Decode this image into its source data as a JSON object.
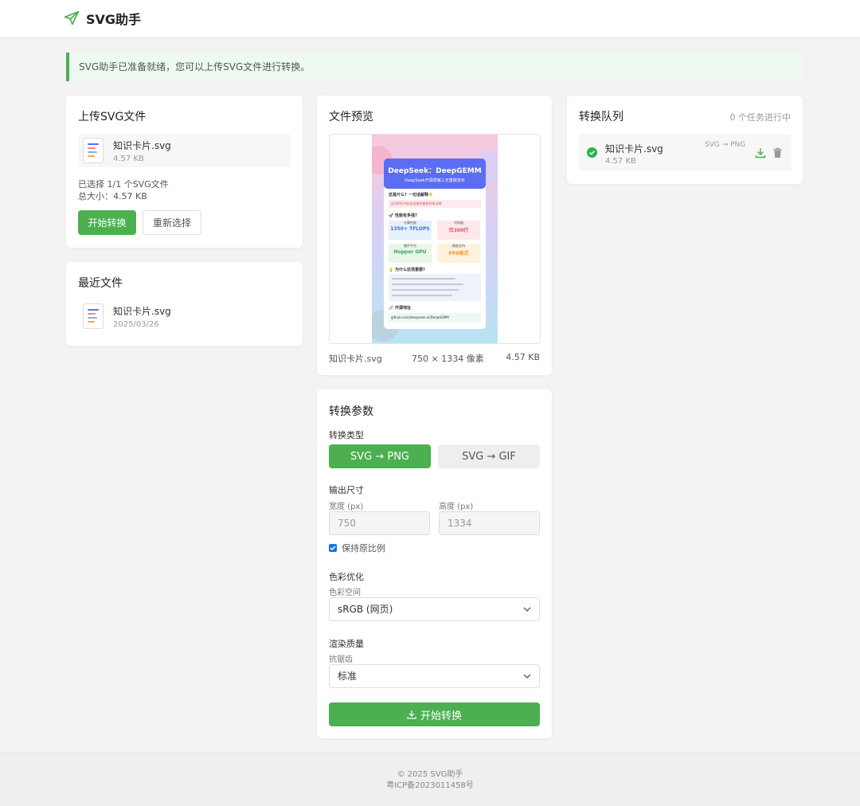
{
  "app": {
    "title": "SVG助手"
  },
  "notice": "SVG助手已准备就绪，您可以上传SVG文件进行转换。",
  "upload": {
    "title": "上传SVG文件",
    "file_name": "知识卡片.svg",
    "file_size": "4.57 KB",
    "selected_text": "已选择 1/1 个SVG文件",
    "total_size": "总大小：4.57 KB",
    "start_button": "开始转换",
    "reselect_button": "重新选择"
  },
  "recent": {
    "title": "最近文件",
    "file_name": "知识卡片.svg",
    "date": "2025/03/26"
  },
  "preview": {
    "title": "文件预览",
    "file_name": "知识卡片.svg",
    "dimensions": "750 × 1334 像素",
    "size": "4.57 KB",
    "card": {
      "heading": "DeepSeek：DeepGEMM",
      "subheading": "DeepSeek开源周第三天重磅发布",
      "q1": "这是什么？一句话解释👇",
      "line1": "仅300行代码实现高性能矩阵乘法库",
      "q2": "🚀 性能有多强?",
      "m1_label": "计算性能",
      "m1_value": "1350+ TFLOPS",
      "m2_label": "代码量",
      "m2_value": "仅300行",
      "m3_label": "硬件平台",
      "m3_value": "Hopper GPU",
      "m4_label": "精度支持",
      "m4_value": "FP8格式",
      "q3": "💡 为什么这很重要?",
      "q4": "🔗 开源地址",
      "link": "github.com/deepseek-ai/DeepGEMM"
    }
  },
  "params": {
    "title": "转换参数",
    "type_label": "转换类型",
    "type_png": "SVG → PNG",
    "type_gif": "SVG → GIF",
    "size_label": "输出尺寸",
    "width_label": "宽度 (px)",
    "height_label": "高度 (px)",
    "width_value": "750",
    "height_value": "1334",
    "keep_ratio": "保持原比例",
    "color_label": "色彩优化",
    "color_space_label": "色彩空间",
    "color_space_value": "sRGB (网页)",
    "quality_label": "渲染质量",
    "aa_label": "抗锯齿",
    "aa_value": "标准",
    "start_button": "开始转换"
  },
  "queue": {
    "title": "转换队列",
    "count": "0 个任务进行中",
    "item_name": "知识卡片.svg",
    "item_size": "4.57 KB",
    "item_type": "SVG → PNG"
  },
  "footer": {
    "copyright": "© 2025 SVG助手",
    "icp": "粤ICP备2023011458号"
  },
  "colors": {
    "accent": "#4caf50",
    "preview_head": "#5b6df2"
  }
}
